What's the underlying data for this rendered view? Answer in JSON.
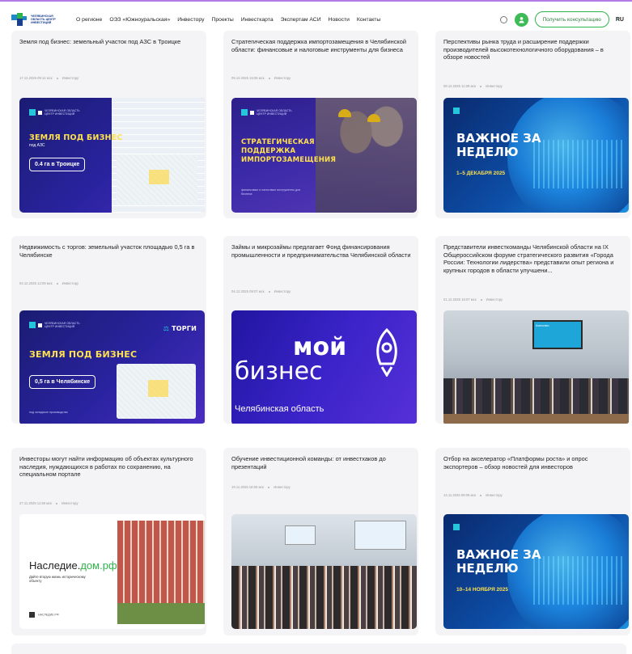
{
  "header": {
    "logo_text": "ЧЕЛЯБИНСКАЯ ОБЛАСТЬ ЦЕНТР ИНВЕСТИЦИЙ",
    "menu": [
      "О регионе",
      "ОЭЗ «Южноуральская»",
      "Инвестору",
      "Проекты",
      "Инвесткарта",
      "Экспертам АСИ",
      "Новости",
      "Контакты"
    ],
    "consult_label": "Получить консультацию",
    "lang": "RU"
  },
  "colors": {
    "accent_green": "#2fb34a",
    "top_line": "#b27be6",
    "card_bg": "#f4f4f6"
  },
  "cards": [
    {
      "title": "Земля под бизнес: земельный участок под АЗС в Троицке",
      "date": "17.12.2025 09:12 мск",
      "category": "Инвестору",
      "banner": {
        "head": "ЗЕМЛЯ ПОД БИЗНЕС",
        "sub": "под АЗС",
        "pill": "0.4 га в Троицке"
      }
    },
    {
      "title": "Стратегическая поддержка импортозамещения в Челябинской области: финансовые и налоговые инструменты для бизнеса",
      "date": "09.12.2025 15:06 мск",
      "category": "Инвестору",
      "banner": {
        "head": "СТРАТЕГИЧЕСКАЯ ПОДДЕРЖКА ИМПОРТОЗАМЕЩЕНИЯ",
        "foot": "финансовые и налоговые инструменты для бизнеса"
      }
    },
    {
      "title": "Перспективы рынка труда и расширение поддержки производителей высокотехнологичного оборудования – в обзоре новостей",
      "date": "08.12.2025 11:08 мск",
      "category": "Инвестору",
      "banner": {
        "head": "ВАЖНОЕ ЗА НЕДЕЛЮ",
        "date": "1–5 ДЕКАБРЯ 2025"
      }
    },
    {
      "title": "Недвижимость с торгов: земельный участок площадью 0,5 га в Челябинске",
      "date": "04.12.2025 12:09 мск",
      "category": "Инвестору",
      "banner": {
        "head": "ЗЕМЛЯ ПОД БИЗНЕС",
        "tag": "ТОРГИ",
        "pill": "0,5 га в Челябинске",
        "foot": "под складское производство"
      }
    },
    {
      "title": "Займы и микрозаймы предлагает Фонд финансирования промышленности и предпринимательства Челябинской области",
      "date": "04.12.2025 09:07 мск",
      "category": "Инвестору",
      "banner": {
        "word1": "мой",
        "word2": "бизнес",
        "region": "Челябинская область"
      }
    },
    {
      "title": "Представители инвесткоманды Челябинской области на IX Общероссийском форуме стратегического развития «Города России: Технологии лидерства» представили опыт региона и крупных городов в области улучшени...",
      "date": "01.12.2025 16:07 мск",
      "category": "Инвестору",
      "banner": {
        "screen": "Агенство"
      }
    },
    {
      "title": "Инвесторы могут найти информацию об объектах культурного наследия, нуждающихся в работах по сохранению, на специальном портале",
      "date": "27.11.2025 11:58 мск",
      "category": "Инвестору",
      "banner": {
        "brand": "Наследие.",
        "brand_green": "дом.рф",
        "sub": "Дайте вторую жизнь историческому объекту",
        "foot": "НАСЛЕДИЕ.РФ"
      }
    },
    {
      "title": "Обучение инвестиционной команды: от инвестхаков до презентаций",
      "date": "19.11.2025 16:05 мск",
      "category": "Инвестору",
      "banner": {}
    },
    {
      "title": "Отбор на акселератор «Платформы роста» и опрос экспортеров – обзор новостей для инвесторов",
      "date": "14.11.2025 09:08 мск",
      "category": "Инвестору",
      "banner": {
        "head": "ВАЖНОЕ ЗА НЕДЕЛЮ",
        "date": "10–14 НОЯБРЯ 2025"
      }
    }
  ]
}
